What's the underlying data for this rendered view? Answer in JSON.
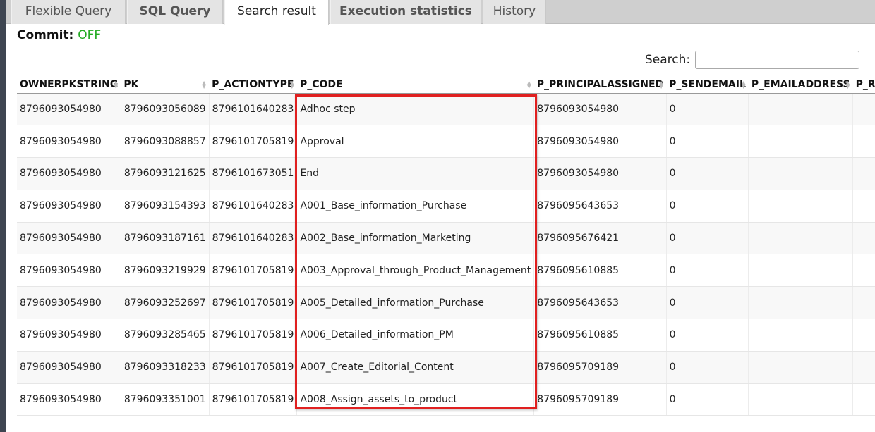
{
  "tabs": [
    {
      "label": "Flexible Query",
      "bold": false,
      "active": false
    },
    {
      "label": "SQL Query",
      "bold": true,
      "active": false
    },
    {
      "label": "Search result",
      "bold": false,
      "active": true
    },
    {
      "label": "Execution statistics",
      "bold": true,
      "active": false
    },
    {
      "label": "History",
      "bold": false,
      "active": false
    }
  ],
  "commit": {
    "label": "Commit:",
    "value": "OFF",
    "value_color": "#22aa22"
  },
  "search": {
    "label": "Search:",
    "value": ""
  },
  "table": {
    "columns": [
      "OWNERPKSTRING",
      "PK",
      "P_ACTIONTYPE",
      "P_CODE",
      "P_PRINCIPALASSIGNED",
      "P_SENDEMAIL",
      "P_EMAILADDRESS",
      "P_R"
    ],
    "rows": [
      [
        "8796093054980",
        "8796093056089",
        "8796101640283",
        "Adhoc step",
        "8796093054980",
        "0",
        "",
        ""
      ],
      [
        "8796093054980",
        "8796093088857",
        "8796101705819",
        "Approval",
        "8796093054980",
        "0",
        "",
        ""
      ],
      [
        "8796093054980",
        "8796093121625",
        "8796101673051",
        "End",
        "8796093054980",
        "0",
        "",
        ""
      ],
      [
        "8796093054980",
        "8796093154393",
        "8796101640283",
        "A001_Base_information_Purchase",
        "8796095643653",
        "0",
        "",
        ""
      ],
      [
        "8796093054980",
        "8796093187161",
        "8796101640283",
        "A002_Base_information_Marketing",
        "8796095676421",
        "0",
        "",
        ""
      ],
      [
        "8796093054980",
        "8796093219929",
        "8796101705819",
        "A003_Approval_through_Product_Management",
        "8796095610885",
        "0",
        "",
        ""
      ],
      [
        "8796093054980",
        "8796093252697",
        "8796101705819",
        "A005_Detailed_information_Purchase",
        "8796095643653",
        "0",
        "",
        ""
      ],
      [
        "8796093054980",
        "8796093285465",
        "8796101705819",
        "A006_Detailed_information_PM",
        "8796095610885",
        "0",
        "",
        ""
      ],
      [
        "8796093054980",
        "8796093318233",
        "8796101705819",
        "A007_Create_Editorial_Content",
        "8796095709189",
        "0",
        "",
        ""
      ],
      [
        "8796093054980",
        "8796093351001",
        "8796101705819",
        "A008_Assign_assets_to_product",
        "8796095709189",
        "0",
        "",
        ""
      ]
    ]
  },
  "colors": {
    "highlight": "#e02020",
    "commit_off": "#22aa22",
    "tabbar": "#cfcfcf"
  }
}
